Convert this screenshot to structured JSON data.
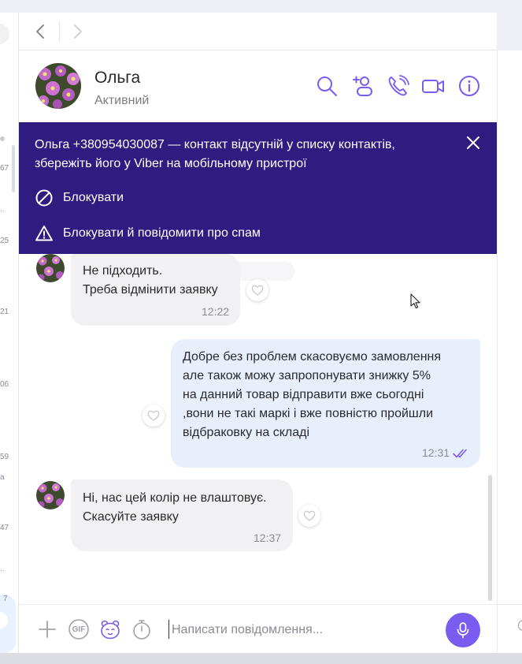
{
  "contact": {
    "name": "Ольга",
    "status": "Активний"
  },
  "banner": {
    "text": "Ольга +380954030087 — контакт відсутній у списку контактів, збережіть його у Viber на мобільному пристрої",
    "block_label": "Блокувати",
    "block_report_label": "Блокувати й повідомити про спам"
  },
  "messages": [
    {
      "direction": "incoming",
      "lines": [
        "Не підходить.",
        "Треба відмінити заявку"
      ],
      "time": "12:22"
    },
    {
      "direction": "outgoing",
      "lines": [
        "Добре без проблем скасовуємо замовлення",
        "але також можу запропонувати знижку 5%",
        "на данний товар відправити вже сьогодні",
        ",вони не такі маркі і вже повністю пройшли",
        "відбраковку на складі"
      ],
      "time": "12:31",
      "read": true
    },
    {
      "direction": "incoming",
      "lines": [
        "Ні, нас цей колір не влаштовує.",
        "Скасуйте заявку"
      ],
      "time": "12:37"
    }
  ],
  "composer": {
    "placeholder": "Написати повідомлення...",
    "gif_label": "GIF"
  },
  "left_panel": {
    "marks": [
      "67",
      "..",
      "25",
      "21",
      "06",
      "59",
      "a",
      "47",
      "..",
      "7"
    ]
  },
  "colors": {
    "banner_bg": "#2f1c81",
    "accent": "#7b5cf0",
    "icon": "#7b5cf0",
    "incoming_bubble": "#f1f1f3",
    "outgoing_bubble": "#e7effb"
  }
}
